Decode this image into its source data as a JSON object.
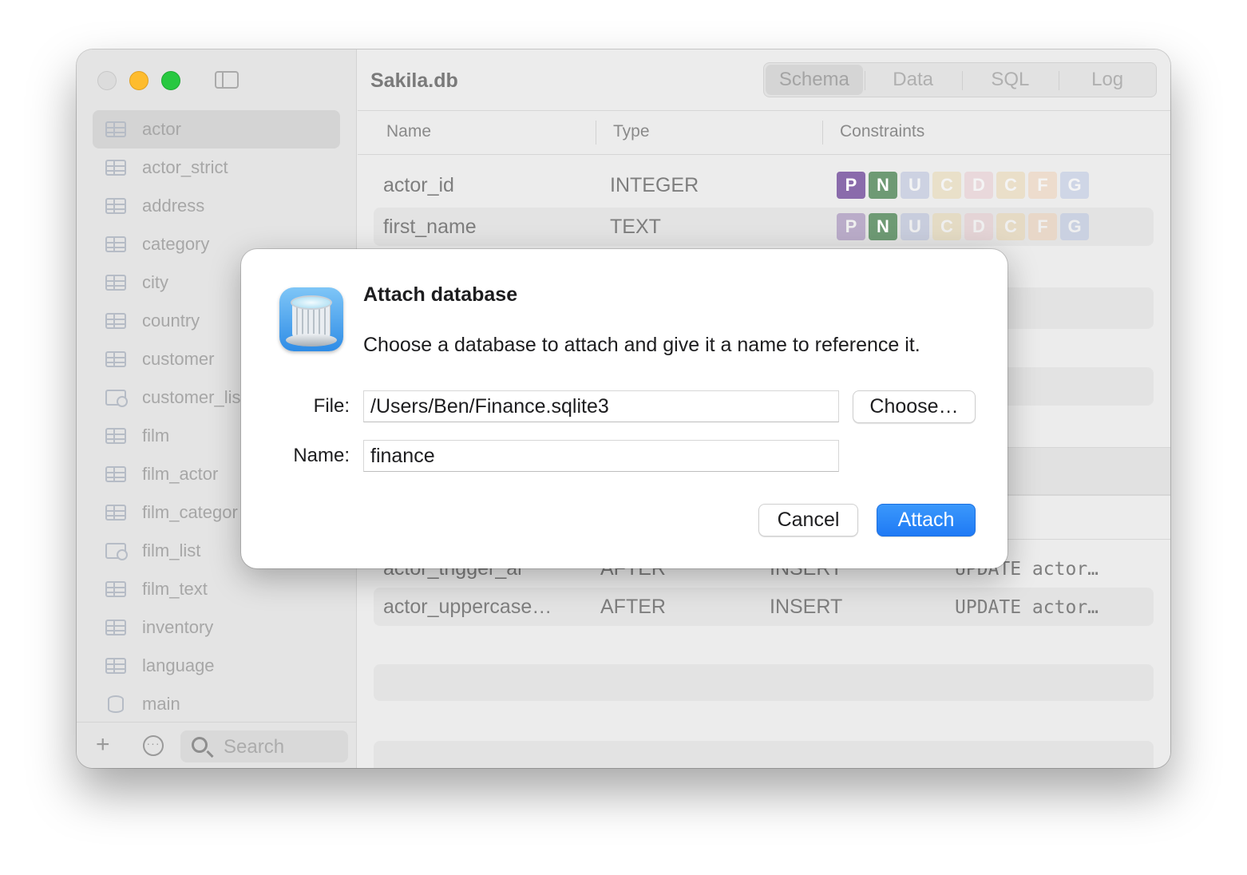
{
  "window": {
    "title": "Sakila.db",
    "tabs": [
      {
        "label": "Schema",
        "active": true
      },
      {
        "label": "Data",
        "active": false
      },
      {
        "label": "SQL",
        "active": false
      },
      {
        "label": "Log",
        "active": false
      }
    ]
  },
  "sidebar": {
    "items": [
      {
        "label": "actor",
        "icon": "table-icon",
        "selected": true
      },
      {
        "label": "actor_strict",
        "icon": "table-icon"
      },
      {
        "label": "address",
        "icon": "table-icon"
      },
      {
        "label": "category",
        "icon": "table-icon"
      },
      {
        "label": "city",
        "icon": "table-icon"
      },
      {
        "label": "country",
        "icon": "table-icon"
      },
      {
        "label": "customer",
        "icon": "table-icon"
      },
      {
        "label": "customer_lis",
        "icon": "view-icon"
      },
      {
        "label": "film",
        "icon": "table-icon"
      },
      {
        "label": "film_actor",
        "icon": "table-icon"
      },
      {
        "label": "film_categor",
        "icon": "table-icon"
      },
      {
        "label": "film_list",
        "icon": "view-icon"
      },
      {
        "label": "film_text",
        "icon": "table-icon"
      },
      {
        "label": "inventory",
        "icon": "table-icon"
      },
      {
        "label": "language",
        "icon": "table-icon"
      },
      {
        "label": "main",
        "icon": "database-icon"
      }
    ],
    "footer": {
      "add_icon": "plus-icon",
      "more_icon": "ellipsis-circle-icon",
      "search_placeholder": "Search"
    }
  },
  "columns_table": {
    "headers": [
      "Name",
      "Type",
      "Constraints"
    ],
    "rows": [
      {
        "name": "actor_id",
        "type": "INTEGER"
      },
      {
        "name": "first_name",
        "type": "TEXT"
      }
    ],
    "constraint_letters": [
      "P",
      "N",
      "U",
      "C",
      "D",
      "C",
      "F",
      "G"
    ],
    "constraint_colors": {
      "P": "#8a6bab",
      "N": "#6e9a74",
      "U": "#a9b4d6",
      "C": "#e6d2a0",
      "D": "#e7c2c8",
      "C2": "#e8d0a0",
      "F": "#efc9a8",
      "G": "#aebce0"
    },
    "constraint_active": [
      [
        true,
        true,
        false,
        false,
        false,
        false,
        false,
        false
      ],
      [
        false,
        true,
        false,
        false,
        false,
        false,
        false,
        false
      ]
    ]
  },
  "triggers_table": {
    "rows": [
      {
        "name": "actor_trigger_ai",
        "timing": "AFTER",
        "event": "INSERT",
        "sql": "UPDATE actor…"
      },
      {
        "name": "actor_uppercase…",
        "timing": "AFTER",
        "event": "INSERT",
        "sql": "UPDATE actor…"
      }
    ]
  },
  "dialog": {
    "title": "Attach database",
    "message": "Choose a database to attach and give it a name to reference it.",
    "file_label": "File:",
    "file_value": "/Users/Ben/Finance.sqlite3",
    "choose_label": "Choose…",
    "name_label": "Name:",
    "name_value": "finance",
    "cancel_label": "Cancel",
    "attach_label": "Attach",
    "accent": "#1f7af5"
  }
}
